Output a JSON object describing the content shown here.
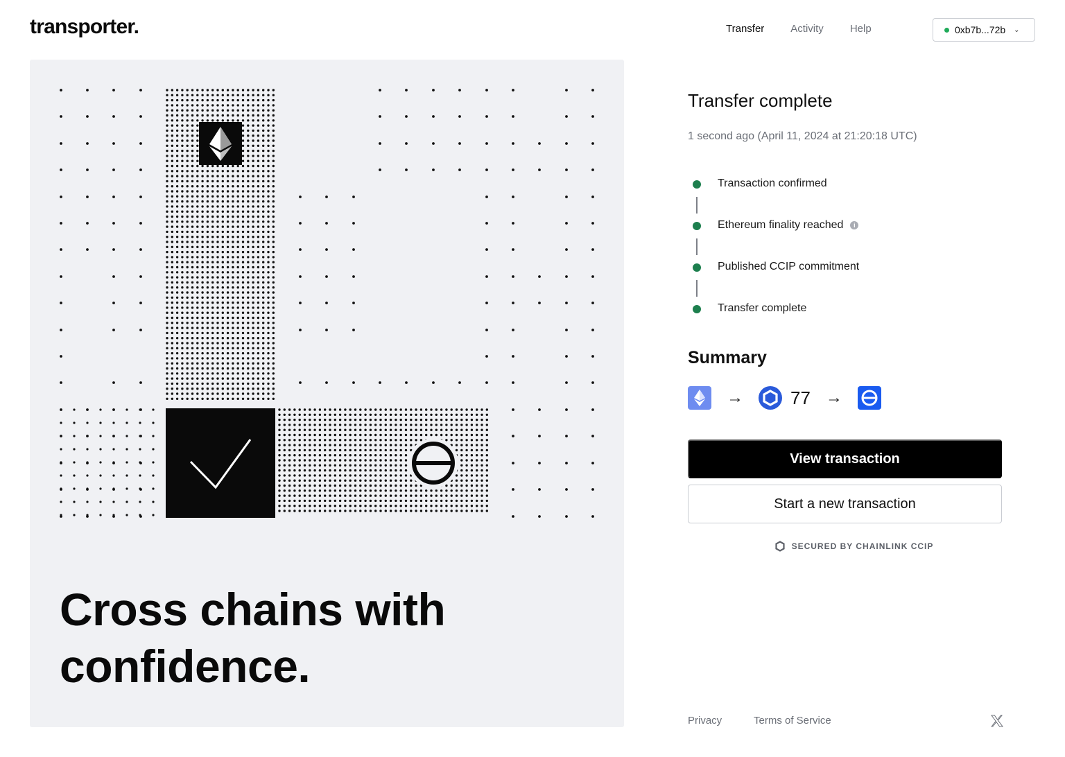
{
  "brand": {
    "logo": "transporter."
  },
  "nav": {
    "items": [
      {
        "label": "Transfer",
        "active": true
      },
      {
        "label": "Activity",
        "active": false
      },
      {
        "label": "Help",
        "active": false
      }
    ]
  },
  "wallet": {
    "address": "0xb7b...72b",
    "status_color": "#1faa59"
  },
  "hero": {
    "tagline_line1": "Cross chains with",
    "tagline_line2": "confidence.",
    "icons": [
      "ethereum-icon",
      "checkmark-icon",
      "destination-chain-icon"
    ]
  },
  "transfer": {
    "title": "Transfer complete",
    "time": "1 second ago (April 11, 2024 at 21:20:18 UTC)",
    "steps": [
      {
        "label": "Transaction confirmed",
        "done": true
      },
      {
        "label": "Ethereum finality reached",
        "done": true,
        "info": true
      },
      {
        "label": "Published CCIP commitment",
        "done": true
      },
      {
        "label": "Transfer complete",
        "done": true
      }
    ]
  },
  "summary": {
    "title": "Summary",
    "source_chain_icon": "ethereum-icon",
    "token_icon": "chainlink-icon",
    "amount": "77",
    "destination_chain_icon": "destination-chain-icon"
  },
  "actions": {
    "view_label": "View transaction",
    "new_label": "Start a new transaction"
  },
  "secured": {
    "label": "SECURED BY CHAINLINK CCIP"
  },
  "footer": {
    "privacy": "Privacy",
    "terms": "Terms of Service"
  },
  "colors": {
    "accent_green": "#1d7f4e",
    "link_blue": "#2a5ada",
    "hero_bg": "#f0f1f4"
  }
}
